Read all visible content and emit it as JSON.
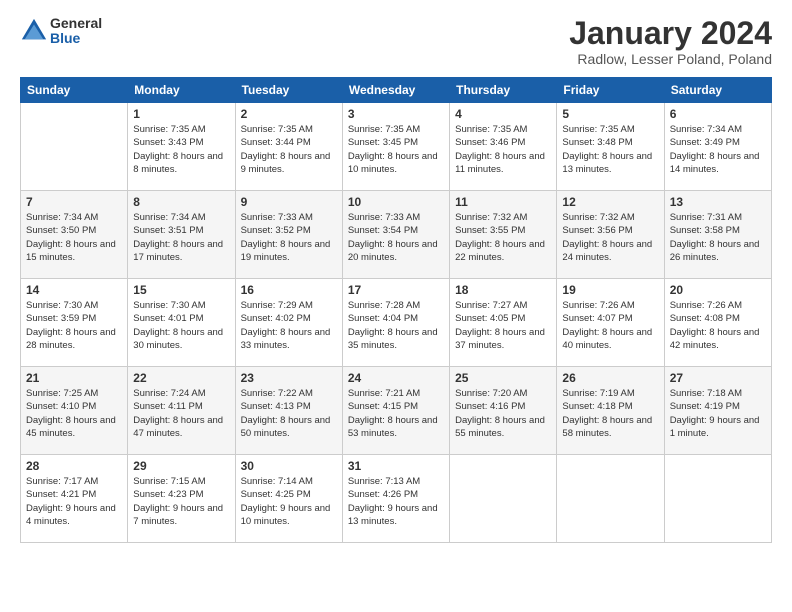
{
  "logo": {
    "general": "General",
    "blue": "Blue"
  },
  "header": {
    "title": "January 2024",
    "location": "Radlow, Lesser Poland, Poland"
  },
  "days_of_week": [
    "Sunday",
    "Monday",
    "Tuesday",
    "Wednesday",
    "Thursday",
    "Friday",
    "Saturday"
  ],
  "weeks": [
    [
      {
        "day": "",
        "sunrise": "",
        "sunset": "",
        "daylight": ""
      },
      {
        "day": "1",
        "sunrise": "Sunrise: 7:35 AM",
        "sunset": "Sunset: 3:43 PM",
        "daylight": "Daylight: 8 hours and 8 minutes."
      },
      {
        "day": "2",
        "sunrise": "Sunrise: 7:35 AM",
        "sunset": "Sunset: 3:44 PM",
        "daylight": "Daylight: 8 hours and 9 minutes."
      },
      {
        "day": "3",
        "sunrise": "Sunrise: 7:35 AM",
        "sunset": "Sunset: 3:45 PM",
        "daylight": "Daylight: 8 hours and 10 minutes."
      },
      {
        "day": "4",
        "sunrise": "Sunrise: 7:35 AM",
        "sunset": "Sunset: 3:46 PM",
        "daylight": "Daylight: 8 hours and 11 minutes."
      },
      {
        "day": "5",
        "sunrise": "Sunrise: 7:35 AM",
        "sunset": "Sunset: 3:48 PM",
        "daylight": "Daylight: 8 hours and 13 minutes."
      },
      {
        "day": "6",
        "sunrise": "Sunrise: 7:34 AM",
        "sunset": "Sunset: 3:49 PM",
        "daylight": "Daylight: 8 hours and 14 minutes."
      }
    ],
    [
      {
        "day": "7",
        "sunrise": "Sunrise: 7:34 AM",
        "sunset": "Sunset: 3:50 PM",
        "daylight": "Daylight: 8 hours and 15 minutes."
      },
      {
        "day": "8",
        "sunrise": "Sunrise: 7:34 AM",
        "sunset": "Sunset: 3:51 PM",
        "daylight": "Daylight: 8 hours and 17 minutes."
      },
      {
        "day": "9",
        "sunrise": "Sunrise: 7:33 AM",
        "sunset": "Sunset: 3:52 PM",
        "daylight": "Daylight: 8 hours and 19 minutes."
      },
      {
        "day": "10",
        "sunrise": "Sunrise: 7:33 AM",
        "sunset": "Sunset: 3:54 PM",
        "daylight": "Daylight: 8 hours and 20 minutes."
      },
      {
        "day": "11",
        "sunrise": "Sunrise: 7:32 AM",
        "sunset": "Sunset: 3:55 PM",
        "daylight": "Daylight: 8 hours and 22 minutes."
      },
      {
        "day": "12",
        "sunrise": "Sunrise: 7:32 AM",
        "sunset": "Sunset: 3:56 PM",
        "daylight": "Daylight: 8 hours and 24 minutes."
      },
      {
        "day": "13",
        "sunrise": "Sunrise: 7:31 AM",
        "sunset": "Sunset: 3:58 PM",
        "daylight": "Daylight: 8 hours and 26 minutes."
      }
    ],
    [
      {
        "day": "14",
        "sunrise": "Sunrise: 7:30 AM",
        "sunset": "Sunset: 3:59 PM",
        "daylight": "Daylight: 8 hours and 28 minutes."
      },
      {
        "day": "15",
        "sunrise": "Sunrise: 7:30 AM",
        "sunset": "Sunset: 4:01 PM",
        "daylight": "Daylight: 8 hours and 30 minutes."
      },
      {
        "day": "16",
        "sunrise": "Sunrise: 7:29 AM",
        "sunset": "Sunset: 4:02 PM",
        "daylight": "Daylight: 8 hours and 33 minutes."
      },
      {
        "day": "17",
        "sunrise": "Sunrise: 7:28 AM",
        "sunset": "Sunset: 4:04 PM",
        "daylight": "Daylight: 8 hours and 35 minutes."
      },
      {
        "day": "18",
        "sunrise": "Sunrise: 7:27 AM",
        "sunset": "Sunset: 4:05 PM",
        "daylight": "Daylight: 8 hours and 37 minutes."
      },
      {
        "day": "19",
        "sunrise": "Sunrise: 7:26 AM",
        "sunset": "Sunset: 4:07 PM",
        "daylight": "Daylight: 8 hours and 40 minutes."
      },
      {
        "day": "20",
        "sunrise": "Sunrise: 7:26 AM",
        "sunset": "Sunset: 4:08 PM",
        "daylight": "Daylight: 8 hours and 42 minutes."
      }
    ],
    [
      {
        "day": "21",
        "sunrise": "Sunrise: 7:25 AM",
        "sunset": "Sunset: 4:10 PM",
        "daylight": "Daylight: 8 hours and 45 minutes."
      },
      {
        "day": "22",
        "sunrise": "Sunrise: 7:24 AM",
        "sunset": "Sunset: 4:11 PM",
        "daylight": "Daylight: 8 hours and 47 minutes."
      },
      {
        "day": "23",
        "sunrise": "Sunrise: 7:22 AM",
        "sunset": "Sunset: 4:13 PM",
        "daylight": "Daylight: 8 hours and 50 minutes."
      },
      {
        "day": "24",
        "sunrise": "Sunrise: 7:21 AM",
        "sunset": "Sunset: 4:15 PM",
        "daylight": "Daylight: 8 hours and 53 minutes."
      },
      {
        "day": "25",
        "sunrise": "Sunrise: 7:20 AM",
        "sunset": "Sunset: 4:16 PM",
        "daylight": "Daylight: 8 hours and 55 minutes."
      },
      {
        "day": "26",
        "sunrise": "Sunrise: 7:19 AM",
        "sunset": "Sunset: 4:18 PM",
        "daylight": "Daylight: 8 hours and 58 minutes."
      },
      {
        "day": "27",
        "sunrise": "Sunrise: 7:18 AM",
        "sunset": "Sunset: 4:19 PM",
        "daylight": "Daylight: 9 hours and 1 minute."
      }
    ],
    [
      {
        "day": "28",
        "sunrise": "Sunrise: 7:17 AM",
        "sunset": "Sunset: 4:21 PM",
        "daylight": "Daylight: 9 hours and 4 minutes."
      },
      {
        "day": "29",
        "sunrise": "Sunrise: 7:15 AM",
        "sunset": "Sunset: 4:23 PM",
        "daylight": "Daylight: 9 hours and 7 minutes."
      },
      {
        "day": "30",
        "sunrise": "Sunrise: 7:14 AM",
        "sunset": "Sunset: 4:25 PM",
        "daylight": "Daylight: 9 hours and 10 minutes."
      },
      {
        "day": "31",
        "sunrise": "Sunrise: 7:13 AM",
        "sunset": "Sunset: 4:26 PM",
        "daylight": "Daylight: 9 hours and 13 minutes."
      },
      {
        "day": "",
        "sunrise": "",
        "sunset": "",
        "daylight": ""
      },
      {
        "day": "",
        "sunrise": "",
        "sunset": "",
        "daylight": ""
      },
      {
        "day": "",
        "sunrise": "",
        "sunset": "",
        "daylight": ""
      }
    ]
  ]
}
